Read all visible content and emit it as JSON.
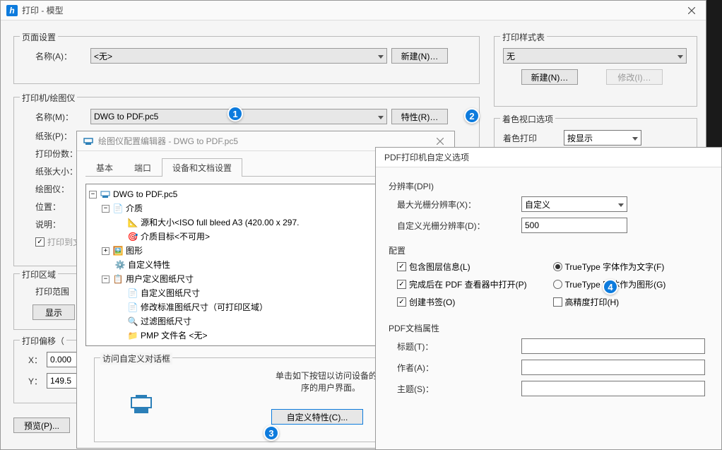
{
  "main": {
    "title": "打印 - 模型",
    "pageSettings": {
      "title": "页面设置",
      "name_label": "名称(A)：",
      "name_value": "<无>",
      "newBtn": "新建(N)…"
    },
    "printer": {
      "title": "打印机/绘图仪",
      "name_label": "名称(M)：",
      "name_value": "DWG to PDF.pc5",
      "propsBtn": "特性(R)…",
      "paper_label": "纸张(P)：",
      "copies_label": "打印份数：",
      "paperSize_label": "纸张大小：",
      "plotter_label": "绘图仪：",
      "location_label": "位置：",
      "desc_label": "说明：",
      "printToFile_label": "打印到文"
    },
    "area": {
      "title": "打印区域",
      "scope_label": "打印范围",
      "showBtn": "显示"
    },
    "offset": {
      "title": "打印偏移（",
      "x_label": "X：",
      "x_val": "0.000",
      "y_label": "Y：",
      "y_val": "149.5"
    },
    "previewBtn": "预览(P)...",
    "styleTable": {
      "title": "打印样式表",
      "value": "无",
      "newBtn": "新建(N)…",
      "modifyBtn": "修改(I)…"
    },
    "viewport": {
      "title": "着色视口选项",
      "shade_label": "着色打印",
      "shade_value": "按显示"
    }
  },
  "editor": {
    "title": "绘图仪配置编辑器 - DWG to PDF.pc5",
    "tabs": [
      "基本",
      "端口",
      "设备和文档设置"
    ],
    "tree": {
      "root": "DWG to PDF.pc5",
      "media": "介质",
      "source": "源和大小<ISO full bleed A3 (420.00 x 297.",
      "target": "介质目标<不可用>",
      "graphics": "图形",
      "custom": "自定义特性",
      "user_sizes": "用户定义图纸尺寸",
      "cust_size": "自定义图纸尺寸",
      "mod_size": "修改标准图纸尺寸（可打印区域）",
      "filter_size": "过滤图纸尺寸",
      "pmp": "PMP 文件名 <无>"
    },
    "dialogGroup": {
      "title": "访问自定义对话框",
      "desc1": "单击如下按钮以访问设备的特",
      "desc2": "序的用户界面。",
      "customBtn": "自定义特性(C)..."
    }
  },
  "pdf": {
    "title": "PDF打印机自定义选项",
    "dpi": {
      "title": "分辨率(DPI)",
      "maxRaster_label": "最大光栅分辨率(X)：",
      "maxRaster_value": "自定义",
      "customRaster_label": "自定义光栅分辨率(D)：",
      "customRaster_value": "500"
    },
    "config": {
      "title": "配置",
      "layers": "包含图层信息(L)",
      "openAfter": "完成后在 PDF 查看器中打开(P)",
      "bookmarks": "创建书签(O)",
      "ttText": "TrueType 字体作为文字(F)",
      "ttGraphic": "TrueType 字体作为图形(G)",
      "hires": "高精度打印(H)"
    },
    "docProps": {
      "title": "PDF文档属性",
      "title_label": "标题(T)：",
      "author_label": "作者(A)：",
      "subject_label": "主题(S)："
    }
  },
  "badges": {
    "b1": "1",
    "b2": "2",
    "b3": "3",
    "b4": "4"
  }
}
